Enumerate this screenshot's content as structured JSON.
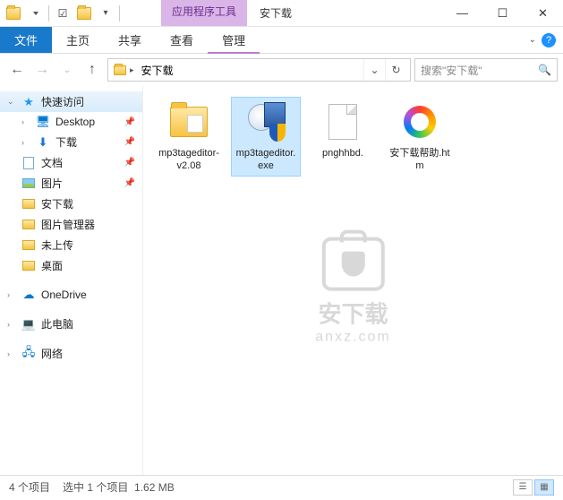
{
  "titlebar": {
    "tool_context": "应用程序工具",
    "window_title": "安下载"
  },
  "ribbon": {
    "file": "文件",
    "tabs": [
      "主页",
      "共享",
      "查看",
      "管理"
    ]
  },
  "address": {
    "location": "安下载",
    "search_placeholder": "搜索\"安下载\""
  },
  "nav": {
    "quick_access": "快速访问",
    "items": [
      {
        "label": "Desktop",
        "pinned": true,
        "icon": "desktop"
      },
      {
        "label": "下载",
        "pinned": true,
        "icon": "download"
      },
      {
        "label": "文档",
        "pinned": true,
        "icon": "document"
      },
      {
        "label": "图片",
        "pinned": true,
        "icon": "picture"
      },
      {
        "label": "安下载",
        "pinned": false,
        "icon": "folder"
      },
      {
        "label": "图片管理器",
        "pinned": false,
        "icon": "folder"
      },
      {
        "label": "未上传",
        "pinned": false,
        "icon": "folder"
      },
      {
        "label": "桌面",
        "pinned": false,
        "icon": "folder"
      }
    ],
    "onedrive": "OneDrive",
    "this_pc": "此电脑",
    "network": "网络"
  },
  "files": [
    {
      "name": "mp3tageditor-v2.08",
      "type": "folder",
      "selected": false
    },
    {
      "name": "mp3tageditor.exe",
      "type": "exe",
      "selected": true
    },
    {
      "name": "pnghhbd.",
      "type": "text",
      "selected": false
    },
    {
      "name": "安下载帮助.htm",
      "type": "htm",
      "selected": false
    }
  ],
  "watermark": {
    "main": "安下载",
    "sub": "anxz",
    "domain": ".com"
  },
  "status": {
    "count": "4 个项目",
    "selection": "选中 1 个项目",
    "size": "1.62 MB"
  }
}
